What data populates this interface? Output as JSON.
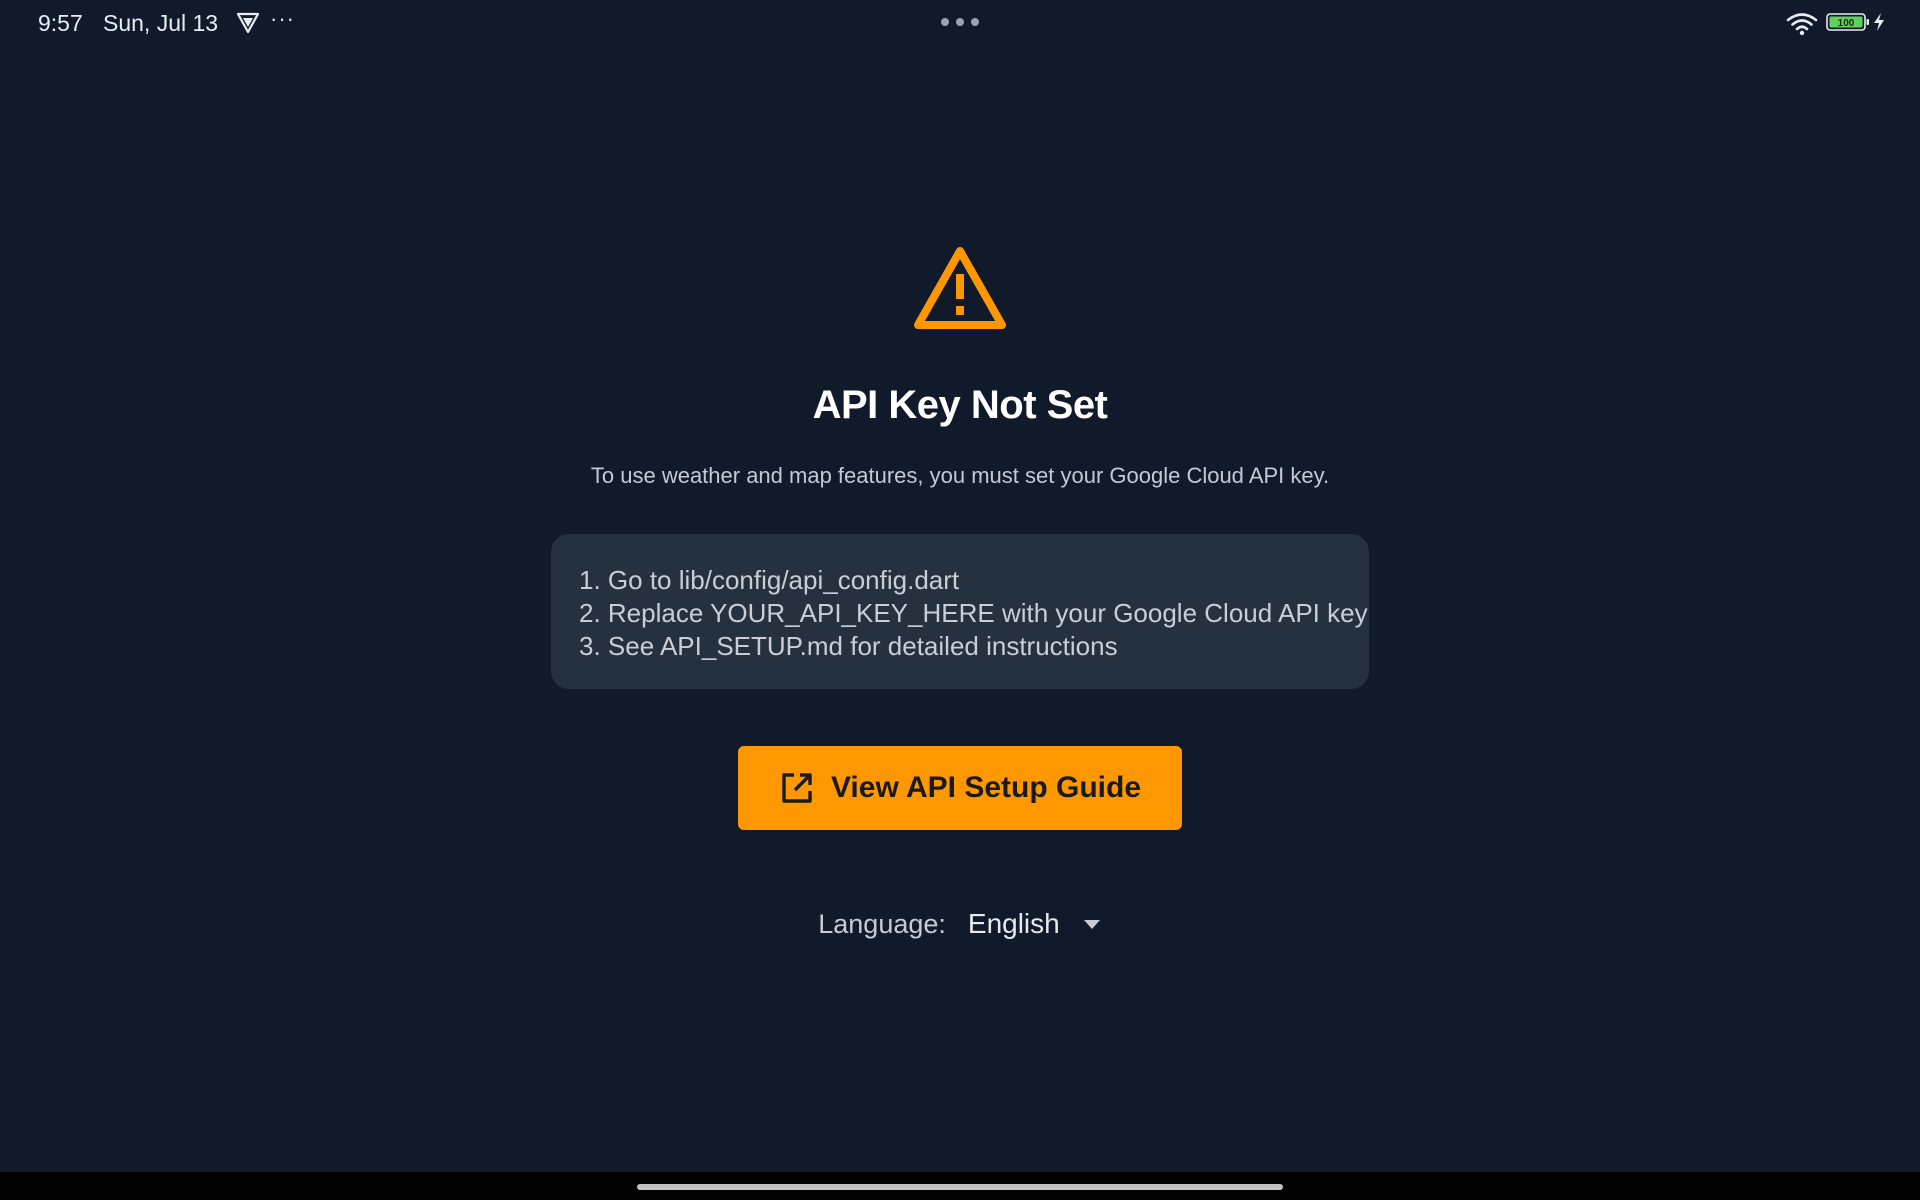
{
  "status_bar": {
    "time": "9:57",
    "date": "Sun, Jul 13",
    "more": "···",
    "battery": "100",
    "icons": [
      "vpn-icon",
      "more-notifications-icon",
      "multitask-dots-icon",
      "wifi-icon",
      "battery-icon",
      "charging-icon"
    ]
  },
  "main": {
    "warning_icon": "warning-triangle-icon",
    "title": "API Key Not Set",
    "subtitle": "To use weather and map features, you must set your Google Cloud API key.",
    "instructions": [
      "1. Go to lib/config/api_config.dart",
      "2. Replace YOUR_API_KEY_HERE with your Google Cloud API key",
      "3. See API_SETUP.md for detailed instructions"
    ],
    "guide_button_label": "View API Setup Guide",
    "guide_button_icon": "open-in-new-icon",
    "language_label": "Language:",
    "language_value": "English"
  },
  "colors": {
    "background": "#111a2b",
    "accent": "#ff9800",
    "card": "#263140"
  }
}
